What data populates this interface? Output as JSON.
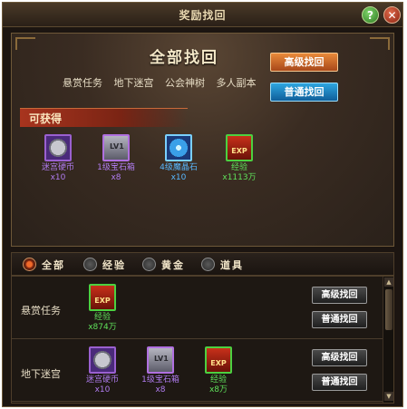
{
  "window": {
    "title": "奖励找回",
    "help_glyph": "?",
    "close_glyph": "✕"
  },
  "header": {
    "title": "全部找回",
    "categories": [
      "悬赏任务",
      "地下迷宫",
      "公会神树",
      "多人副本"
    ],
    "advanced_button": "高级找回",
    "normal_button": "普通找回"
  },
  "obtainable": {
    "label": "可获得",
    "items": [
      {
        "name": "迷宫硬币",
        "count": "x10",
        "icon": "maze-coin-icon",
        "color": "purple"
      },
      {
        "name": "1级宝石箱",
        "count": "x8",
        "icon": "gem-box-icon",
        "color": "purple",
        "tag": "LV1"
      },
      {
        "name": "4级魔晶石",
        "count": "x10",
        "icon": "magic-crystal-icon",
        "color": "blue"
      },
      {
        "name": "经验",
        "count": "x1113万",
        "icon": "exp-icon",
        "color": "green",
        "tag": "EXP"
      }
    ]
  },
  "filters": [
    {
      "label": "全部",
      "selected": true
    },
    {
      "label": "经验",
      "selected": false
    },
    {
      "label": "黄金",
      "selected": false
    },
    {
      "label": "道具",
      "selected": false
    }
  ],
  "rows": [
    {
      "name": "悬赏任务",
      "items": [
        {
          "name": "经验",
          "count": "x874万",
          "icon": "exp-icon",
          "color": "green",
          "tag": "EXP"
        }
      ],
      "advanced_button": "高级找回",
      "normal_button": "普通找回"
    },
    {
      "name": "地下迷宫",
      "items": [
        {
          "name": "迷宫硬币",
          "count": "x10",
          "icon": "maze-coin-icon",
          "color": "purple"
        },
        {
          "name": "1级宝石箱",
          "count": "x8",
          "icon": "gem-box-icon",
          "color": "purple",
          "tag": "LV1"
        },
        {
          "name": "经验",
          "count": "x8万",
          "icon": "exp-icon",
          "color": "green",
          "tag": "EXP"
        }
      ],
      "advanced_button": "高级找回",
      "normal_button": "普通找回"
    }
  ],
  "scrollbar": {
    "up_glyph": "▲",
    "down_glyph": "▼"
  },
  "colors": {
    "accent_orange": "#e98a3a",
    "accent_blue": "#2ea6e0",
    "rarity_purple": "#b07cf0",
    "rarity_blue": "#58b8ff",
    "rarity_green": "#5fe05a"
  }
}
